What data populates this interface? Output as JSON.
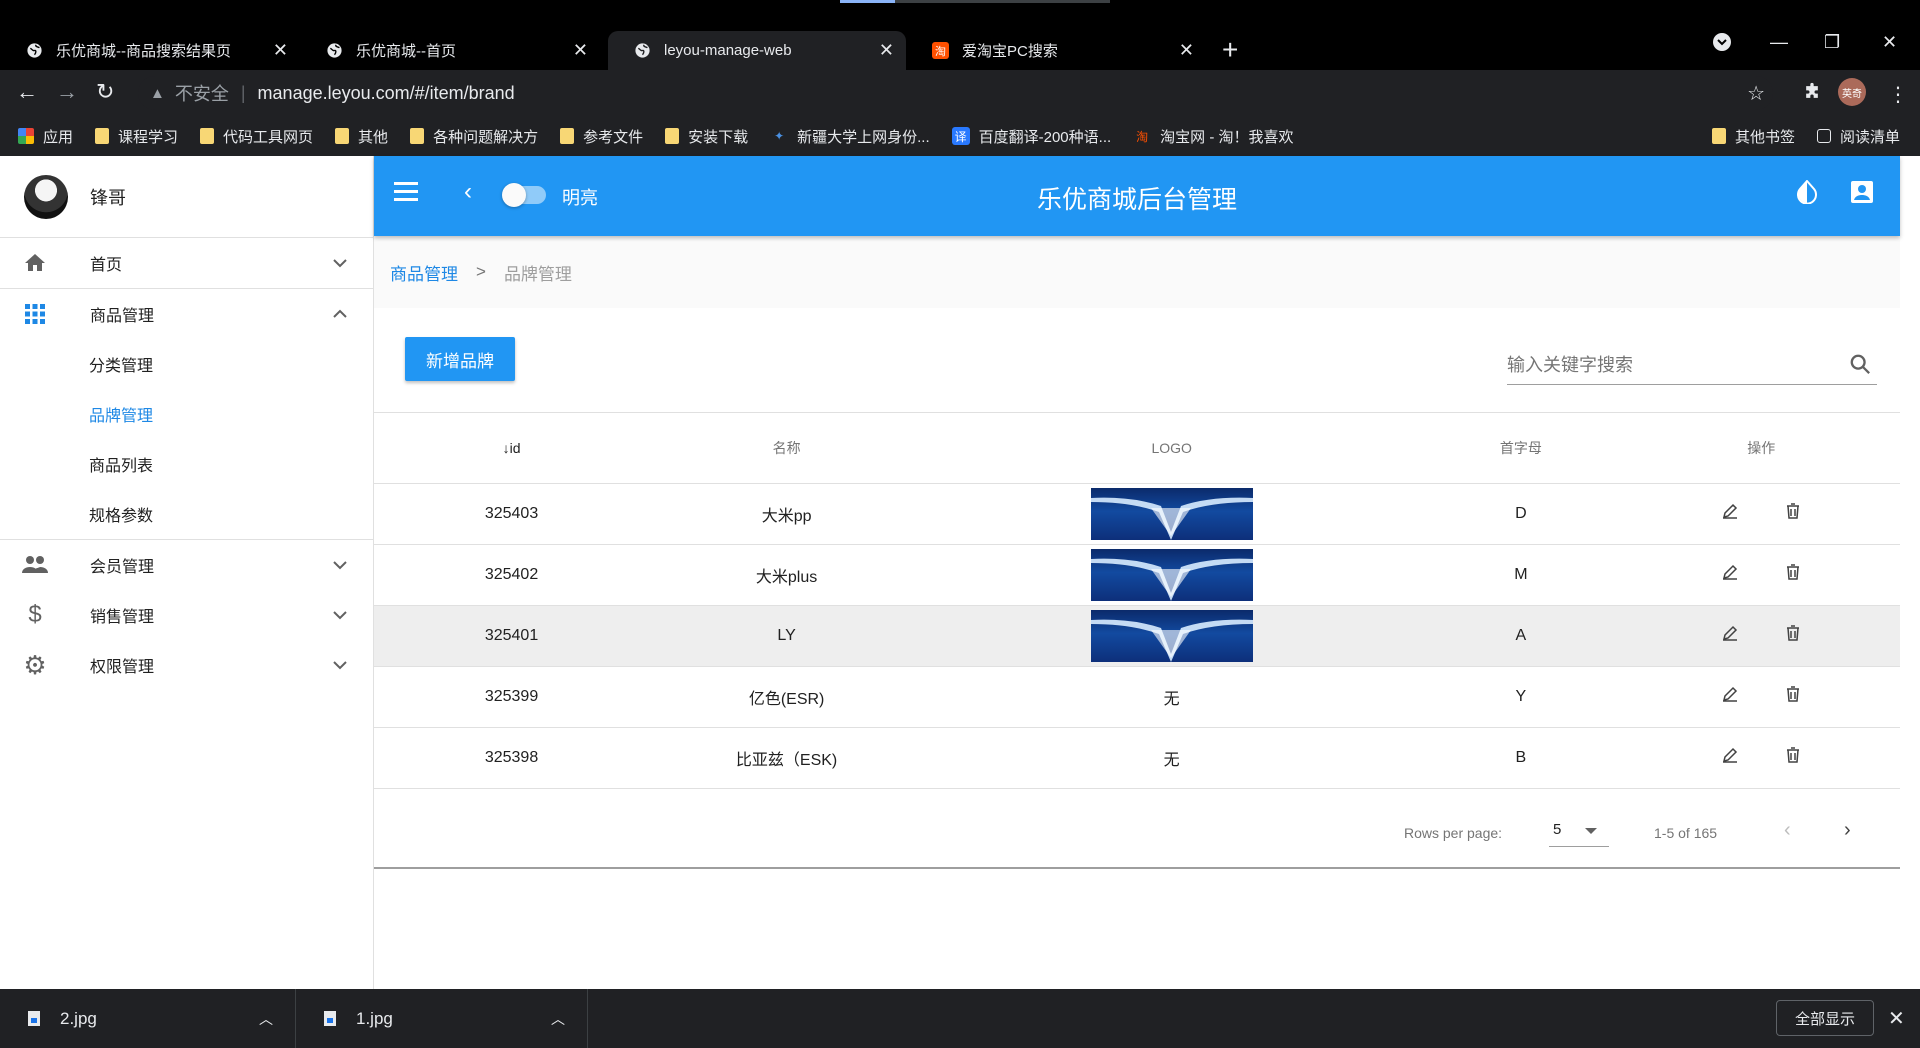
{
  "browser": {
    "tabs": [
      {
        "label": "乐优商城--商品搜索结果页",
        "active": false
      },
      {
        "label": "乐优商城--首页",
        "active": false
      },
      {
        "label": "leyou-manage-web",
        "active": true
      },
      {
        "label": "爱淘宝PC搜索",
        "active": false
      }
    ],
    "new_tab": "+",
    "address": {
      "insecure_label": "不安全",
      "url": "manage.leyou.com/#/item/brand"
    },
    "profile_label": "英奇",
    "bookmarks": [
      {
        "label": "应用",
        "icon": "apps-grid-icon"
      },
      {
        "label": "课程学习",
        "icon": "folder-icon"
      },
      {
        "label": "代码工具网页",
        "icon": "folder-icon"
      },
      {
        "label": "其他",
        "icon": "folder-icon"
      },
      {
        "label": "各种问题解决方",
        "icon": "folder-icon"
      },
      {
        "label": "参考文件",
        "icon": "folder-icon"
      },
      {
        "label": "安装下载",
        "icon": "folder-icon"
      },
      {
        "label": "新疆大学上网身份...",
        "icon": "site-icon"
      },
      {
        "label": "百度翻译-200种语...",
        "icon": "translate-icon"
      },
      {
        "label": "淘宝网 - 淘！我喜欢",
        "icon": "taobao-icon"
      }
    ],
    "bookmarks_right": [
      {
        "label": "其他书签",
        "icon": "folder-icon"
      },
      {
        "label": "阅读清单",
        "icon": "reading-list-icon"
      }
    ]
  },
  "sidebar": {
    "user_name": "锋哥",
    "items": [
      {
        "label": "首页",
        "icon": "home-icon",
        "expanded": false
      },
      {
        "label": "商品管理",
        "icon": "apps-icon",
        "expanded": true,
        "children": [
          {
            "label": "分类管理",
            "active": false
          },
          {
            "label": "品牌管理",
            "active": true
          },
          {
            "label": "商品列表",
            "active": false
          },
          {
            "label": "规格参数",
            "active": false
          }
        ]
      },
      {
        "label": "会员管理",
        "icon": "people-icon",
        "expanded": false
      },
      {
        "label": "销售管理",
        "icon": "dollar-icon",
        "expanded": false
      },
      {
        "label": "权限管理",
        "icon": "settings-icon",
        "expanded": false
      }
    ]
  },
  "toolbar": {
    "title": "乐优商城后台管理",
    "theme_label": "明亮",
    "theme_on": false
  },
  "breadcrumb": {
    "parent": "商品管理",
    "separator": ">",
    "current": "品牌管理"
  },
  "brand_page": {
    "add_button": "新增品牌",
    "search_placeholder": "输入关键字搜索",
    "columns": [
      "id",
      "名称",
      "LOGO",
      "首字母",
      "操作"
    ],
    "sort_indicator": "↓",
    "rows": [
      {
        "id": "325403",
        "name": "大米pp",
        "logo": "image",
        "letter": "D"
      },
      {
        "id": "325402",
        "name": "大米plus",
        "logo": "image",
        "letter": "M"
      },
      {
        "id": "325401",
        "name": "LY",
        "logo": "image",
        "letter": "A"
      },
      {
        "id": "325399",
        "name": "亿色(ESR)",
        "logo": "无",
        "letter": "Y"
      },
      {
        "id": "325398",
        "name": "比亚兹（ESK)",
        "logo": "无",
        "letter": "B"
      }
    ],
    "rows_per_page_label": "Rows per page:",
    "rows_per_page": "5",
    "range_text": "1-5 of 165"
  },
  "downloads": {
    "items": [
      "2.jpg",
      "1.jpg"
    ],
    "show_all": "全部显示"
  },
  "colors": {
    "primary": "#2196f3",
    "link": "#1e88e5",
    "chrome_dark": "#202124"
  }
}
